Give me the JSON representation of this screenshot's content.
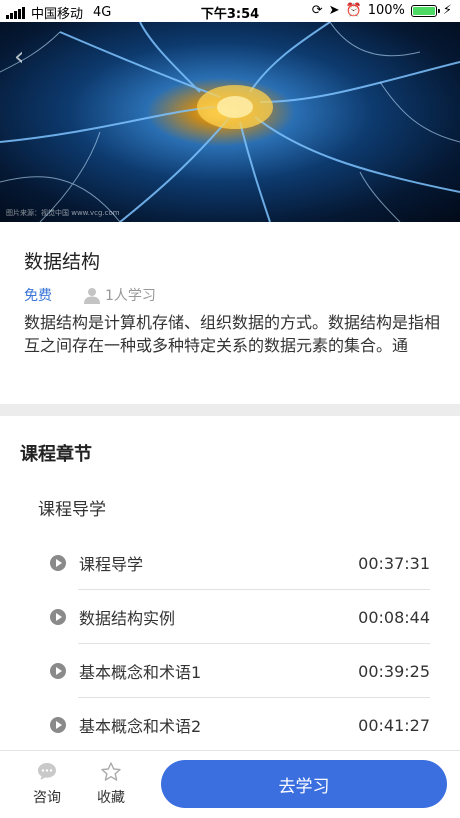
{
  "status_bar": {
    "carrier": "中国移动",
    "network": "4G",
    "time": "下午3:54",
    "battery": "100%"
  },
  "hero": {
    "watermark": "图片来源：视觉中国 www.vcg.com"
  },
  "course": {
    "title": "数据结构",
    "price": "免费",
    "learners": "1人学习",
    "description": "数据结构是计算机存储、组织数据的方式。数据结构是指相互之间存在一种或多种特定关系的数据元素的集合。通"
  },
  "chapters": {
    "heading": "课程章节",
    "chapter_title": "课程导学",
    "lessons": [
      {
        "name": "课程导学",
        "duration": "00:37:31"
      },
      {
        "name": "数据结构实例",
        "duration": "00:08:44"
      },
      {
        "name": "基本概念和术语1",
        "duration": "00:39:25"
      },
      {
        "name": "基本概念和术语2",
        "duration": "00:41:27"
      }
    ]
  },
  "bottom_bar": {
    "consult_label": "咨询",
    "favorite_label": "收藏",
    "study_button": "去学习"
  },
  "colors": {
    "accent": "#3b6fe0",
    "free_text": "#3a75d6",
    "battery": "#4cd964"
  }
}
